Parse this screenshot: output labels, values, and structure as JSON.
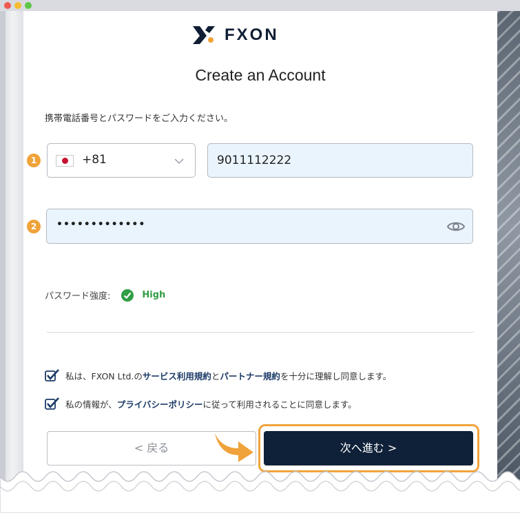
{
  "window": {
    "controls": [
      "close",
      "minimize",
      "maximize"
    ]
  },
  "brand": {
    "name": "FXON"
  },
  "page": {
    "title": "Create an Account",
    "instruction": "携帯電話番号とパスワードをご入力ください。"
  },
  "steps": {
    "phone": "1",
    "password": "2"
  },
  "phone": {
    "country_code": "+81",
    "flag_icon": "japan-flag-icon",
    "number": "9011112222"
  },
  "password": {
    "masked_value": "•••••••••••••",
    "toggle_icon": "eye-icon"
  },
  "strength": {
    "label": "パスワード強度:",
    "value": "High"
  },
  "consents": [
    {
      "prefix": "私は、FXON Ltd.の",
      "link1": "サービス利用規約",
      "middle": "と",
      "link2": "パートナー規約",
      "suffix": "を十分に理解し同意します。",
      "checked": true
    },
    {
      "prefix": "私の情報が、",
      "link1": "プライバシーポリシー",
      "suffix": "に従って利用されることに同意します。",
      "checked": true
    }
  ],
  "buttons": {
    "back": "< 戻る",
    "next": "次へ進む >"
  },
  "colors": {
    "navy": "#0f2138",
    "accent_orange": "#f0a33a",
    "input_fill": "#eaf4fd",
    "strength_green": "#2f9e44"
  }
}
